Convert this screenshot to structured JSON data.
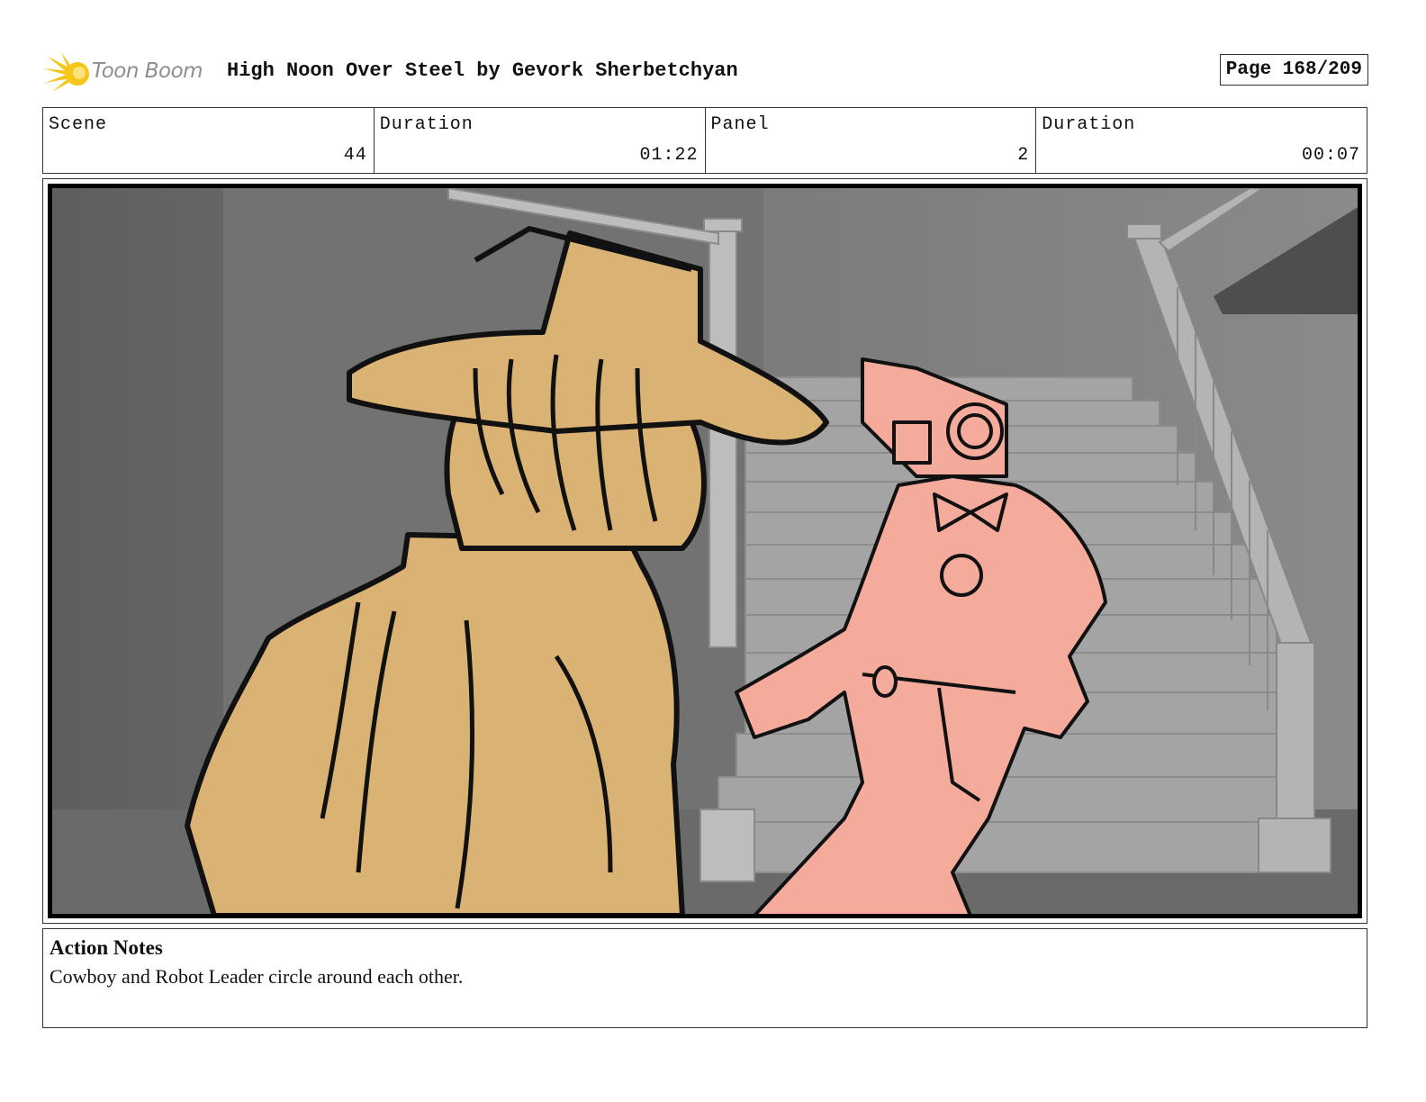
{
  "header": {
    "logo_text": "Toon Boom",
    "title": "High Noon Over Steel by Gevork Sherbetchyan",
    "page": "Page 168/209"
  },
  "info": {
    "scene_label": "Scene",
    "scene_value": "44",
    "scene_duration_label": "Duration",
    "scene_duration_value": "01:22",
    "panel_label": "Panel",
    "panel_value": "2",
    "panel_duration_label": "Duration",
    "panel_duration_value": "00:07"
  },
  "notes": {
    "heading": "Action Notes",
    "text": "Cowboy and Robot Leader circle around each other."
  },
  "colors": {
    "cowboy": "#d9b274",
    "robot": "#f5ab9c",
    "background": "#6e6e6e",
    "logo_accent": "#f5c518"
  }
}
